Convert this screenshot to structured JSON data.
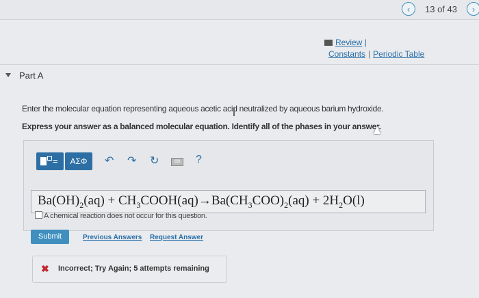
{
  "nav": {
    "prev_symbol": "‹",
    "counter": "13 of 43",
    "next_symbol": "›"
  },
  "resources": {
    "review_label": "Review",
    "review_sep": "|",
    "constants_label": "Constants",
    "periodic_table_label": "Periodic Table"
  },
  "part": {
    "title": "Part A"
  },
  "question": {
    "line1": "Enter the molecular equation representing aqueous acetic acid neutralized by aqueous barium hydroxide.",
    "line2": "Express your answer as a balanced molecular equation. Identify all of the phases in your answer."
  },
  "toolbar": {
    "greek_label": "ΑΣΦ",
    "undo_icon": "↶",
    "redo_icon": "↷",
    "reset_icon": "↻",
    "help_label": "?"
  },
  "answer": {
    "p1": "Ba(OH)",
    "s1": "2",
    "p2": "(aq) + CH",
    "s2": "3",
    "p3": "COOH(aq)→Ba(CH",
    "s3": "3",
    "p4": "COO)",
    "s4": "2",
    "p5": "(aq) + 2H",
    "s5": "2",
    "p6": "O(l)"
  },
  "no_reaction_label": "A chemical reaction does not occur for this question.",
  "actions": {
    "submit": "Submit",
    "previous_answers": "Previous Answers",
    "request_answer": "Request Answer"
  },
  "feedback": {
    "icon": "✖",
    "message": "Incorrect; Try Again; 5 attempts remaining"
  },
  "colors": {
    "accent": "#3f8fbf",
    "toolbar_blue": "#2d6fa5",
    "error": "#c1272d"
  }
}
